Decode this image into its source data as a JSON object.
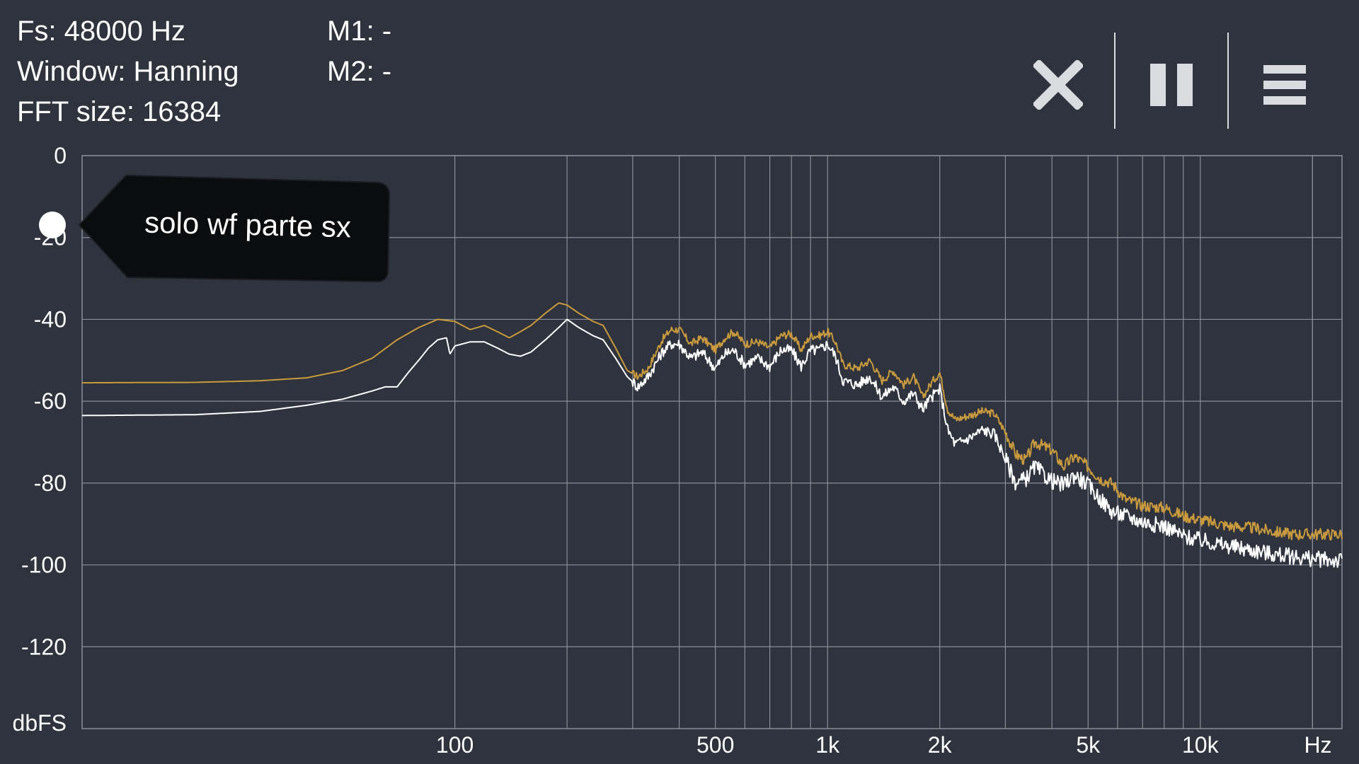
{
  "info": {
    "fs": "Fs: 48000 Hz",
    "window": "Window: Hanning",
    "fft_size": "FFT size: 16384",
    "m1": "M1: -",
    "m2": "M2: -"
  },
  "toolbar": {
    "close_icon": "close-icon",
    "pause_icon": "pause-icon",
    "menu_icon": "menu-icon"
  },
  "tooltip": {
    "label": "solo wf parte sx"
  },
  "colors": {
    "background": "#2e333d",
    "grid": "#8a8e96",
    "series_peak": "#c99a3e",
    "series_live": "#ffffff",
    "tooltip_bg": "#0b0c0e"
  },
  "chart_data": {
    "type": "line",
    "title": "",
    "xlabel": "Hz",
    "ylabel": "dbFS",
    "x_scale": "log",
    "xlim": [
      10,
      24000
    ],
    "ylim": [
      -140,
      0
    ],
    "y_ticks": [
      "0",
      "-20",
      "-40",
      "-60",
      "-80",
      "-100",
      "-120"
    ],
    "y_tick_values": [
      0,
      -20,
      -40,
      -60,
      -80,
      -100,
      -120
    ],
    "x_ticks": [
      "100",
      "500",
      "1k",
      "2k",
      "5k",
      "10k"
    ],
    "x_tick_values": [
      100,
      500,
      1000,
      2000,
      5000,
      10000
    ],
    "grid": true,
    "series": [
      {
        "color": "#c99a3e",
        "points": [
          [
            10,
            -55.5
          ],
          [
            20,
            -55.4
          ],
          [
            30,
            -55.0
          ],
          [
            40,
            -54.3
          ],
          [
            50,
            -52.5
          ],
          [
            60,
            -49.5
          ],
          [
            70,
            -45.0
          ],
          [
            80,
            -42.0
          ],
          [
            90,
            -40.0
          ],
          [
            100,
            -40.5
          ],
          [
            110,
            -42.5
          ],
          [
            120,
            -41.5
          ],
          [
            130,
            -43.0
          ],
          [
            140,
            -44.5
          ],
          [
            150,
            -43.0
          ],
          [
            160,
            -41.5
          ],
          [
            175,
            -38.5
          ],
          [
            190,
            -36.0
          ],
          [
            200,
            -36.5
          ],
          [
            215,
            -38.5
          ],
          [
            235,
            -40.5
          ],
          [
            250,
            -41.5
          ],
          [
            270,
            -47.0
          ],
          [
            290,
            -52.5
          ],
          [
            310,
            -54.0
          ],
          [
            330,
            -52.0
          ],
          [
            360,
            -45.0
          ],
          [
            380,
            -42.5
          ],
          [
            400,
            -42.5
          ],
          [
            430,
            -46.0
          ],
          [
            460,
            -44.5
          ],
          [
            500,
            -47.5
          ],
          [
            530,
            -44.5
          ],
          [
            560,
            -43.0
          ],
          [
            600,
            -46.0
          ],
          [
            650,
            -45.5
          ],
          [
            700,
            -47.0
          ],
          [
            750,
            -44.0
          ],
          [
            800,
            -43.5
          ],
          [
            850,
            -47.5
          ],
          [
            900,
            -44.0
          ],
          [
            950,
            -44.0
          ],
          [
            1000,
            -43.0
          ],
          [
            1050,
            -45.5
          ],
          [
            1100,
            -51.0
          ],
          [
            1200,
            -52.0
          ],
          [
            1300,
            -50.0
          ],
          [
            1400,
            -55.0
          ],
          [
            1500,
            -52.5
          ],
          [
            1600,
            -56.0
          ],
          [
            1700,
            -54.0
          ],
          [
            1800,
            -59.0
          ],
          [
            1900,
            -55.5
          ],
          [
            2000,
            -53.0
          ],
          [
            2100,
            -62.0
          ],
          [
            2200,
            -64.5
          ],
          [
            2400,
            -63.5
          ],
          [
            2600,
            -62.5
          ],
          [
            2800,
            -63.0
          ],
          [
            3000,
            -67.5
          ],
          [
            3200,
            -73.0
          ],
          [
            3400,
            -74.5
          ],
          [
            3600,
            -70.0
          ],
          [
            3800,
            -71.0
          ],
          [
            4000,
            -72.0
          ],
          [
            4300,
            -76.0
          ],
          [
            4600,
            -73.5
          ],
          [
            5000,
            -76.0
          ],
          [
            5400,
            -79.0
          ],
          [
            5800,
            -80.0
          ],
          [
            6300,
            -84.0
          ],
          [
            7000,
            -85.5
          ],
          [
            8000,
            -86.0
          ],
          [
            9000,
            -88.0
          ],
          [
            10000,
            -89.0
          ],
          [
            12000,
            -90.5
          ],
          [
            14000,
            -91.0
          ],
          [
            16000,
            -92.0
          ],
          [
            18000,
            -92.5
          ],
          [
            20000,
            -92.5
          ],
          [
            24000,
            -92.5
          ]
        ]
      },
      {
        "color": "#ffffff",
        "points": [
          [
            10,
            -63.5
          ],
          [
            20,
            -63.3
          ],
          [
            30,
            -62.5
          ],
          [
            40,
            -61.0
          ],
          [
            50,
            -59.5
          ],
          [
            60,
            -57.5
          ],
          [
            65,
            -56.5
          ],
          [
            70,
            -56.5
          ],
          [
            75,
            -53.0
          ],
          [
            80,
            -50.0
          ],
          [
            85,
            -47.0
          ],
          [
            90,
            -45.0
          ],
          [
            95,
            -44.5
          ],
          [
            97,
            -48.5
          ],
          [
            100,
            -46.5
          ],
          [
            110,
            -45.5
          ],
          [
            120,
            -45.5
          ],
          [
            130,
            -47.0
          ],
          [
            140,
            -48.5
          ],
          [
            150,
            -49.0
          ],
          [
            160,
            -48.0
          ],
          [
            175,
            -45.0
          ],
          [
            190,
            -42.0
          ],
          [
            200,
            -40.0
          ],
          [
            215,
            -42.0
          ],
          [
            235,
            -44.0
          ],
          [
            250,
            -45.0
          ],
          [
            270,
            -49.5
          ],
          [
            290,
            -54.0
          ],
          [
            310,
            -56.5
          ],
          [
            330,
            -54.0
          ],
          [
            360,
            -48.0
          ],
          [
            380,
            -46.0
          ],
          [
            400,
            -46.0
          ],
          [
            430,
            -49.5
          ],
          [
            460,
            -48.0
          ],
          [
            500,
            -52.0
          ],
          [
            530,
            -48.5
          ],
          [
            560,
            -47.5
          ],
          [
            600,
            -51.0
          ],
          [
            650,
            -49.5
          ],
          [
            700,
            -51.5
          ],
          [
            750,
            -47.5
          ],
          [
            800,
            -47.5
          ],
          [
            850,
            -51.5
          ],
          [
            900,
            -47.5
          ],
          [
            950,
            -47.5
          ],
          [
            1000,
            -46.0
          ],
          [
            1050,
            -49.0
          ],
          [
            1100,
            -55.0
          ],
          [
            1200,
            -56.0
          ],
          [
            1300,
            -54.0
          ],
          [
            1400,
            -59.0
          ],
          [
            1500,
            -56.5
          ],
          [
            1600,
            -60.0
          ],
          [
            1700,
            -58.0
          ],
          [
            1800,
            -62.0
          ],
          [
            1900,
            -59.0
          ],
          [
            2000,
            -57.0
          ],
          [
            2100,
            -67.0
          ],
          [
            2200,
            -70.5
          ],
          [
            2400,
            -69.0
          ],
          [
            2600,
            -67.0
          ],
          [
            2800,
            -68.0
          ],
          [
            3000,
            -74.0
          ],
          [
            3200,
            -80.0
          ],
          [
            3400,
            -79.0
          ],
          [
            3600,
            -76.0
          ],
          [
            3800,
            -78.0
          ],
          [
            4000,
            -79.5
          ],
          [
            4300,
            -80.5
          ],
          [
            4600,
            -78.0
          ],
          [
            5000,
            -80.5
          ],
          [
            5400,
            -84.0
          ],
          [
            5800,
            -87.0
          ],
          [
            6300,
            -88.0
          ],
          [
            7000,
            -89.5
          ],
          [
            8000,
            -90.5
          ],
          [
            9000,
            -93.0
          ],
          [
            10000,
            -94.0
          ],
          [
            12000,
            -95.5
          ],
          [
            14000,
            -96.5
          ],
          [
            16000,
            -97.5
          ],
          [
            18000,
            -98.0
          ],
          [
            20000,
            -98.5
          ],
          [
            24000,
            -99.0
          ]
        ]
      }
    ]
  }
}
